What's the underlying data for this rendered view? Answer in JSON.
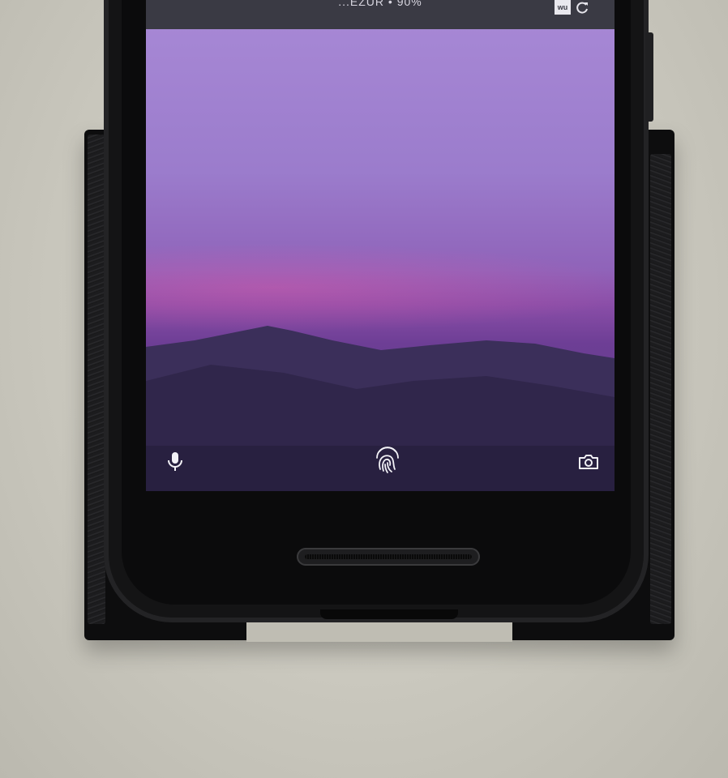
{
  "status_bar": {
    "text": "...EZUR • 90%",
    "badge_text": "wu",
    "refresh_icon": "refresh-icon"
  },
  "lock_screen": {
    "left_shortcut_icon": "microphone-icon",
    "center_icon": "fingerprint-icon",
    "right_shortcut_icon": "camera-icon"
  },
  "colors": {
    "sky_top": "#a889d6",
    "sky_glow": "#dc5aaa",
    "mountain": "#3b2f5a",
    "surface": "#cfcdc4",
    "phone_body": "#141415"
  }
}
